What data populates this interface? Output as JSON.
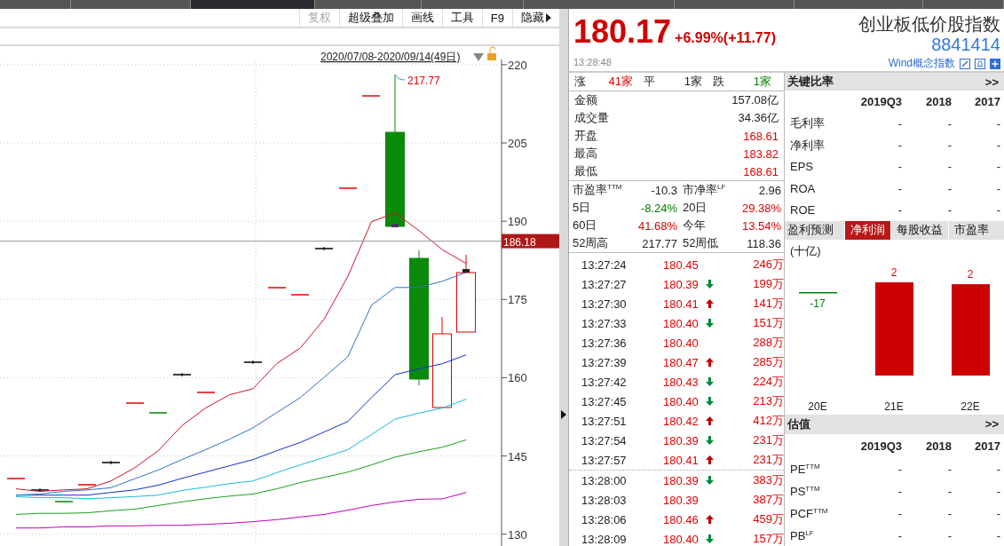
{
  "tab_bar": {
    "tabs": [
      {
        "selected": false
      },
      {
        "selected": false
      },
      {
        "selected": true
      },
      {
        "selected": false
      },
      {
        "selected": false
      },
      {
        "selected": false
      },
      {
        "selected": false
      },
      {
        "selected": false
      },
      {
        "selected": false
      }
    ]
  },
  "chart_toolbar": [
    {
      "label": "复权",
      "disabled": true,
      "kind": "button"
    },
    {
      "label": "超级叠加",
      "disabled": false,
      "kind": "button"
    },
    {
      "label": "画线",
      "disabled": false,
      "kind": "button"
    },
    {
      "label": "工具",
      "disabled": false,
      "kind": "button"
    },
    {
      "label": "F9",
      "disabled": false,
      "kind": "button"
    },
    {
      "label": "隐藏",
      "disabled": false,
      "kind": "menu"
    }
  ],
  "kline": {
    "date_range": "2020/07/08-2020/09/14(49日)",
    "high_label": "217.77",
    "chart_data": {
      "type": "line",
      "ylim": [
        127.4,
        221
      ],
      "grid": true,
      "ref_lines": [
        {
          "axis": "y",
          "value": 186.18,
          "label": "186.18"
        }
      ],
      "yticks": [
        220,
        205,
        190,
        175,
        160,
        145,
        130
      ],
      "series": [
        {
          "color": "#d0102a",
          "values": [
            138.7,
            138.2,
            138.5,
            138.7,
            140.2,
            142.7,
            146.0,
            150.8,
            154.2,
            156.7,
            157.9,
            162.7,
            165.7,
            171.2,
            179.4,
            189.9,
            191.6,
            188.2,
            184.5,
            181.9
          ]
        },
        {
          "color": "#3070c0",
          "values": [
            137.5,
            137.7,
            138.2,
            138.5,
            138.9,
            140.6,
            142.3,
            144.3,
            146.2,
            148.2,
            150.4,
            153.3,
            156.2,
            160.1,
            164.0,
            173.9,
            177.3,
            177.3,
            178.5,
            180.2
          ]
        },
        {
          "color": "#1030d0",
          "values": [
            137.5,
            137.5,
            137.5,
            137.5,
            138.0,
            138.5,
            139.4,
            140.7,
            141.9,
            143.1,
            144.3,
            146.0,
            147.6,
            149.6,
            151.6,
            156.2,
            160.6,
            161.7,
            162.7,
            164.4
          ]
        },
        {
          "color": "#1ab8d8",
          "values": [
            137.2,
            137.0,
            137.0,
            136.8,
            137.0,
            137.2,
            137.5,
            138.4,
            139.0,
            139.7,
            140.2,
            141.8,
            143.3,
            144.7,
            146.2,
            149.1,
            152.1,
            153.2,
            154.2,
            155.9
          ]
        },
        {
          "color": "#1aa01a",
          "values": [
            133.8,
            134.0,
            134.0,
            134.1,
            134.5,
            134.8,
            135.5,
            136.2,
            136.8,
            137.3,
            137.7,
            138.7,
            139.9,
            140.9,
            141.9,
            143.3,
            144.8,
            145.8,
            146.7,
            148.1
          ]
        },
        {
          "color": "#c000c0",
          "values": [
            131.2,
            131.2,
            131.4,
            131.4,
            131.6,
            131.6,
            131.7,
            131.7,
            131.9,
            132.1,
            132.4,
            132.8,
            133.3,
            133.8,
            134.6,
            135.5,
            136.2,
            136.7,
            136.8,
            138.0
          ]
        }
      ]
    }
  },
  "quote": {
    "price": "180.17",
    "change": "+6.99%(+11.77)",
    "time": "13:28:48",
    "name": "创业板低价股指数",
    "code": "8841414",
    "category_link": "Wind概念指数"
  },
  "breadth": [
    {
      "label": "涨",
      "value": "41家",
      "color": "#e00000"
    },
    {
      "label": "平",
      "value": "1家",
      "color": "#222222"
    },
    {
      "label": "跌",
      "value": "1家",
      "color": "#008000"
    }
  ],
  "stats": [
    {
      "label": "金额",
      "value": "157.08亿",
      "color": "#222222"
    },
    {
      "label": "成交量",
      "value": "34.36亿",
      "color": "#222222"
    },
    {
      "label": "开盘",
      "value": "168.61",
      "color": "#e00000"
    },
    {
      "label": "最高",
      "value": "183.82",
      "color": "#e00000"
    },
    {
      "label": "最低",
      "value": "168.61",
      "color": "#e00000"
    }
  ],
  "metrics": [
    {
      "label": "市盈率$^{TTM}$",
      "value": "-10.3",
      "color": "#222222"
    },
    {
      "label": "市净率$^{LF}$",
      "value": "2.96",
      "color": "#222222"
    },
    {
      "label": "5日",
      "value": "-8.24%",
      "color": "#008000"
    },
    {
      "label": "20日",
      "value": "29.38%",
      "color": "#e00000"
    },
    {
      "label": "60日",
      "value": "41.68%",
      "color": "#e00000"
    },
    {
      "label": "今年",
      "value": "13.54%",
      "color": "#e00000"
    },
    {
      "label": "52周高",
      "value": "217.77",
      "color": "#222222"
    },
    {
      "label": "52周低",
      "value": "118.36",
      "color": "#222222"
    }
  ],
  "trade_groups": [
    [
      {
        "time": "13:27:24",
        "price": "180.45",
        "kind": "plain",
        "volume": "246万"
      },
      {
        "time": "13:27:27",
        "price": "180.39",
        "kind": "downtick",
        "volume": "199万"
      },
      {
        "time": "13:27:30",
        "price": "180.41",
        "kind": "uptick",
        "volume": "141万"
      },
      {
        "time": "13:27:33",
        "price": "180.40",
        "kind": "downtick",
        "volume": "151万"
      },
      {
        "time": "13:27:36",
        "price": "180.40",
        "kind": "plain",
        "volume": "288万"
      },
      {
        "time": "13:27:39",
        "price": "180.47",
        "kind": "uptick",
        "volume": "285万"
      },
      {
        "time": "13:27:42",
        "price": "180.43",
        "kind": "downtick",
        "volume": "224万"
      },
      {
        "time": "13:27:45",
        "price": "180.40",
        "kind": "downtick",
        "volume": "213万"
      },
      {
        "time": "13:27:51",
        "price": "180.42",
        "kind": "uptick",
        "volume": "412万"
      },
      {
        "time": "13:27:54",
        "price": "180.39",
        "kind": "downtick",
        "volume": "231万"
      },
      {
        "time": "13:27:57",
        "price": "180.41",
        "kind": "uptick",
        "volume": "231万"
      }
    ],
    [
      {
        "time": "13:28:00",
        "price": "180.39",
        "kind": "downtick",
        "volume": "383万"
      },
      {
        "time": "13:28:03",
        "price": "180.39",
        "kind": "plain",
        "volume": "387万"
      },
      {
        "time": "13:28:06",
        "price": "180.46",
        "kind": "uptick",
        "volume": "459万"
      },
      {
        "time": "13:28:09",
        "price": "180.40",
        "kind": "downtick",
        "volume": "157万"
      }
    ]
  ],
  "ratios": {
    "title": "关键比率",
    "more": ">>",
    "columns": [
      "2019Q3",
      "2018",
      "2017"
    ],
    "rows": [
      {
        "label": "毛利率",
        "values": [
          "-",
          "-",
          "-"
        ]
      },
      {
        "label": "净利率",
        "values": [
          "-",
          "-",
          "-"
        ]
      },
      {
        "label": "EPS",
        "values": [
          "-",
          "-",
          "-"
        ]
      },
      {
        "label": "ROA",
        "values": [
          "-",
          "-",
          "-"
        ]
      },
      {
        "label": "ROE",
        "values": [
          "-",
          "-",
          "-"
        ]
      }
    ]
  },
  "forecast": {
    "title": "盈利预测",
    "tabs": [
      {
        "label": "净利润",
        "selected": true
      },
      {
        "label": "每股收益",
        "selected": false
      },
      {
        "label": "市盈率",
        "selected": false
      }
    ],
    "unit": "(十亿)",
    "bars": [
      {
        "category": "20E",
        "value": "-17",
        "kind": "negative"
      },
      {
        "category": "21E",
        "value": "2",
        "kind": "positive"
      },
      {
        "category": "22E",
        "value": "2",
        "kind": "positive"
      }
    ]
  },
  "valuation": {
    "title": "估值",
    "more": ">>",
    "columns": [
      "2019Q3",
      "2018",
      "2017"
    ],
    "rows": [
      {
        "label": "PE$^{TTM}$",
        "values": [
          "-",
          "-",
          "-"
        ]
      },
      {
        "label": "PS$^{TTM}$",
        "values": [
          "-",
          "-",
          "-"
        ]
      },
      {
        "label": "PCF$^{TTM}$",
        "values": [
          "-",
          "-",
          "-"
        ]
      },
      {
        "label": "PB$^{LF}$",
        "values": [
          "-",
          "-",
          "-"
        ]
      }
    ]
  }
}
